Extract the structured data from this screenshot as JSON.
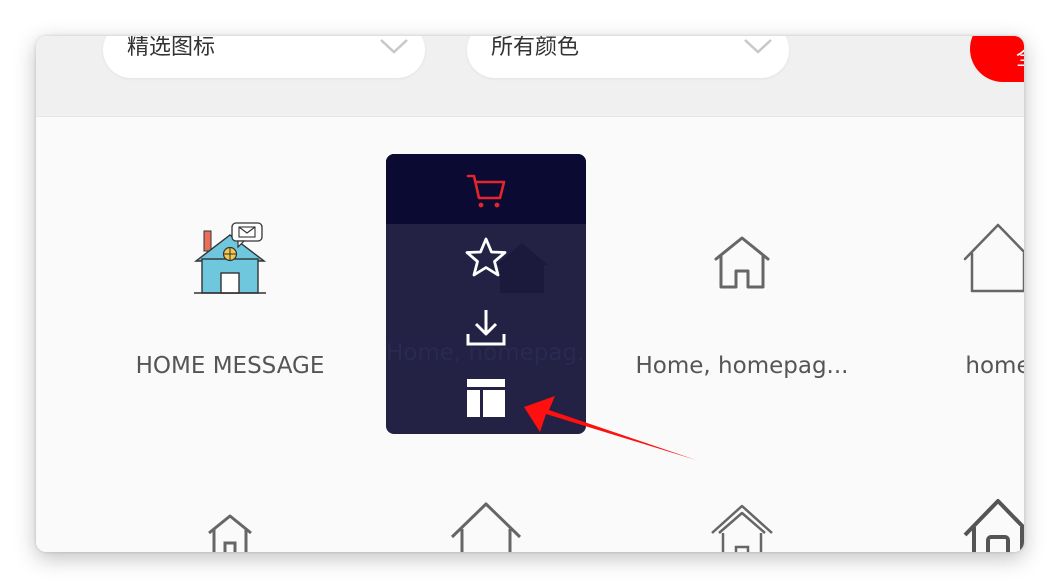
{
  "filters": {
    "icon_filter": "精选图标",
    "color_filter": "所有颜色",
    "action_button": "全"
  },
  "icons": [
    {
      "caption": "HOME MESSAGE",
      "icon": "home-message-icon"
    },
    {
      "caption": "Home, homepag...",
      "icon": "home-icon"
    },
    {
      "caption": "Home, homepag...",
      "icon": "home-outline-icon"
    },
    {
      "caption": "home",
      "icon": "home-outline-icon"
    }
  ],
  "hover_menu": {
    "items": [
      "cart-icon",
      "star-icon",
      "download-icon",
      "layout-icon"
    ]
  },
  "colors": {
    "accent": "#ff0000",
    "panel": "#1a183c",
    "panel_top": "#0b0a33",
    "cart": "#e6242b"
  }
}
